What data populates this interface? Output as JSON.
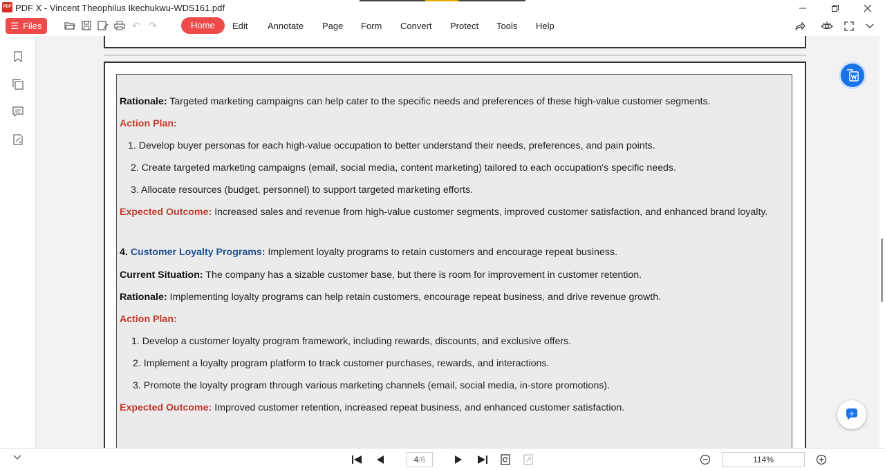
{
  "window": {
    "logo_text": "PDF",
    "title": "PDF X - Vincent Theophilus Ikechukwu-WDS161.pdf"
  },
  "menubar": {
    "files_label": "Files",
    "menu": [
      "Home",
      "Edit",
      "Annotate",
      "Page",
      "Form",
      "Convert",
      "Protect",
      "Tools",
      "Help"
    ],
    "active_menu": "Home"
  },
  "document": {
    "lines": [
      {
        "label": "Rationale:",
        "text": " Targeted marketing campaigns can help cater to the specific needs and preferences of these high-value customer segments."
      },
      {
        "label": "Action Plan:",
        "text": ""
      },
      {
        "label": "",
        "text": "1. Develop buyer personas for each high-value occupation to better understand their needs, preferences, and pain points."
      },
      {
        "label": "",
        "text": "2. Create targeted marketing campaigns (email, social media, content marketing) tailored to each occupation's specific needs."
      },
      {
        "label": "",
        "text": "3. Allocate resources (budget, personnel) to support targeted marketing efforts."
      },
      {
        "label": "Expected Outcome:",
        "text": " Increased sales and revenue from high-value customer segments, improved customer satisfaction, and enhanced brand loyalty."
      },
      {
        "label": "4. ",
        "label2": "Customer Loyalty Programs:",
        "text": " Implement loyalty programs to retain customers and encourage repeat business."
      },
      {
        "label": "Current Situation:",
        "text": " The company has a sizable customer base, but there is room for improvement in customer retention."
      },
      {
        "label": "Rationale:",
        "text": " Implementing loyalty programs can help retain customers, encourage repeat business, and drive revenue growth."
      },
      {
        "label": "Action Plan:",
        "text": ""
      },
      {
        "label": "",
        "text": "1. Develop a customer loyalty program framework, including rewards, discounts, and exclusive offers."
      },
      {
        "label": "",
        "text": "2. Implement a loyalty program platform to track customer purchases, rewards, and interactions."
      },
      {
        "label": "",
        "text": "3. Promote the loyalty program through various marketing channels (email, social media, in-store promotions)."
      },
      {
        "label": "Expected Outcome:",
        "text": " Improved customer retention, increased repeat business, and enhanced customer satisfaction."
      }
    ]
  },
  "pager": {
    "current": "4",
    "total": "/6",
    "zoom": "114%"
  },
  "colors": {
    "accent": "#ef4a4a",
    "heading_red": "#c0392b",
    "heading_blue": "#1f4e8c",
    "float_blue": "#1a73e8"
  }
}
